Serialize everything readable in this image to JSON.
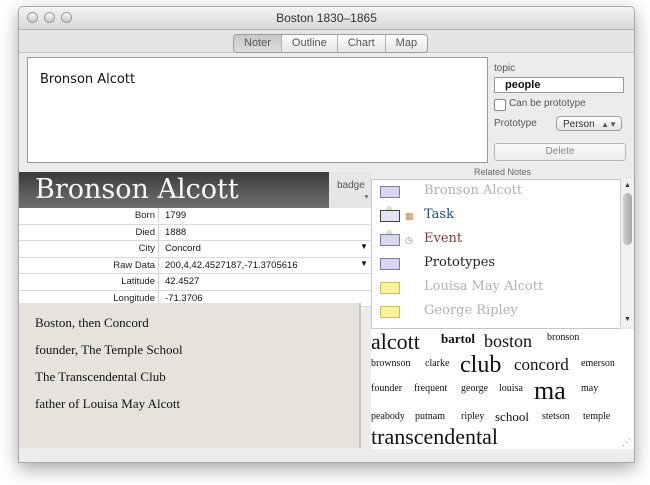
{
  "window": {
    "title": "Boston 1830–1865"
  },
  "tabs": [
    {
      "label": "Noter",
      "selected": true
    },
    {
      "label": "Outline",
      "selected": false
    },
    {
      "label": "Chart",
      "selected": false
    },
    {
      "label": "Map",
      "selected": false
    }
  ],
  "note": {
    "text": "Bronson Alcott"
  },
  "inspector": {
    "topic_label": "topic",
    "topic_value": "people",
    "prototype_checkbox_label": "Can be prototype",
    "prototype_label": "Prototype",
    "prototype_value": "Person",
    "delete_label": "Delete"
  },
  "banner": {
    "title": "Bronson Alcott",
    "badge_label": "badge"
  },
  "attributes": [
    {
      "name": "Born",
      "value": "1799"
    },
    {
      "name": "Died",
      "value": "1888"
    },
    {
      "name": "City",
      "value": "Concord",
      "has_menu": true
    },
    {
      "name": "Raw Data",
      "value": "200,4,42.4527187,-71.3705616",
      "has_menu": true
    },
    {
      "name": "Latitude",
      "value": "42.4527"
    },
    {
      "name": "Longitude",
      "value": "-71.3706"
    }
  ],
  "notes_text": [
    "Boston, then Concord",
    "founder, The Temple School",
    "The Transcendental Club",
    "father of Louisa May Alcott"
  ],
  "related": {
    "header": "Related Notes",
    "items": [
      {
        "label": "Bronson Alcott",
        "color": "#b0b0b0",
        "icon": "lav"
      },
      {
        "label": "Task",
        "color": "#1f4b8a",
        "icon": "sel",
        "mini": "calendar-icon"
      },
      {
        "label": "Event",
        "color": "#7a3a3a",
        "icon": "lav",
        "mini": "clock-icon"
      },
      {
        "label": "Prototypes",
        "color": "#222222",
        "icon": "lav"
      },
      {
        "label": "Louisa May Alcott",
        "color": "#b0b0b0",
        "icon": "yel"
      },
      {
        "label": "George Ripley",
        "color": "#b0b0b0",
        "icon": "yel"
      }
    ]
  },
  "word_cloud": [
    {
      "text": "alcott",
      "size": 22
    },
    {
      "text": "bartol",
      "size": 13,
      "weight": "bold"
    },
    {
      "text": "boston",
      "size": 18
    },
    {
      "text": "bronson",
      "size": 10
    },
    {
      "text": "brownson",
      "size": 10
    },
    {
      "text": "clarke",
      "size": 10
    },
    {
      "text": "club",
      "size": 24
    },
    {
      "text": "concord",
      "size": 17
    },
    {
      "text": "emerson",
      "size": 10
    },
    {
      "text": "founder",
      "size": 10
    },
    {
      "text": "frequent",
      "size": 10
    },
    {
      "text": "george",
      "size": 10
    },
    {
      "text": "louisa",
      "size": 10
    },
    {
      "text": "ma",
      "size": 26
    },
    {
      "text": "may",
      "size": 10
    },
    {
      "text": "peabody",
      "size": 10
    },
    {
      "text": "putnam",
      "size": 10
    },
    {
      "text": "ripley",
      "size": 10
    },
    {
      "text": "school",
      "size": 13
    },
    {
      "text": "stetson",
      "size": 10
    },
    {
      "text": "temple",
      "size": 10
    },
    {
      "text": "transcendental",
      "size": 22
    }
  ]
}
